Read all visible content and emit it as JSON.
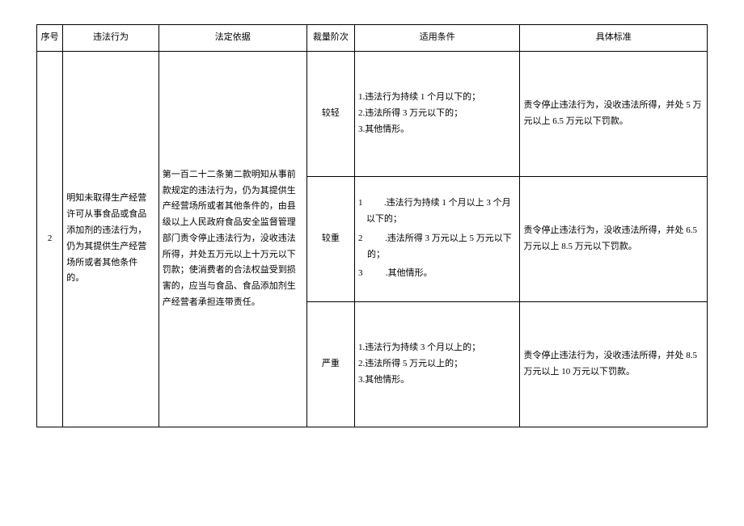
{
  "headers": {
    "seq": "序号",
    "violation": "违法行为",
    "basis": "法定依据",
    "level": "裁量阶次",
    "condition": "适用条件",
    "standard": "具体标准"
  },
  "row": {
    "seq": "2",
    "violation": "明知未取得生产经营许可从事食品或食品添加剂的违法行为，仍为其提供生产经营场所或者其他条件的。",
    "basis": "第一百二十二条第二款明知从事前款规定的违法行为，仍为其提供生产经营场所或者其他条件的，由县级以上人民政府食品安全监督管理部门责令停止违法行为，没收违法所得，并处五万元以上十万元以下罚款；使消费者的合法权益受到损害的，应当与食品、食品添加剂生产经营者承担连带责任。",
    "levels": {
      "light": {
        "name": "较轻",
        "condition_1": "1.违法行为持续 1 个月以下的；",
        "condition_2": "2.违法所得 3 万元以下的；",
        "condition_3": "3.其他情形。",
        "standard": "责令停止违法行为，没收违法所得，并处 5 万元以上 6.5 万元以下罚款。"
      },
      "heavy": {
        "name": "较重",
        "condition_1_num": "1",
        "condition_1_txt": "　　.违法行为持续 1 个月以上 3 个月以下的；",
        "condition_2_num": "2",
        "condition_2_txt": "　　.违法所得 3 万元以上 5 万元以下的；",
        "condition_3_num": "3",
        "condition_3_txt": "　　.其他情形。",
        "standard": "责令停止违法行为，没收违法所得，并处 6.5 万元以上 8.5 万元以下罚款。"
      },
      "severe": {
        "name": "严重",
        "condition_1": "1.违法行为持续 3 个月以上的；",
        "condition_2": "2.违法所得 5 万元以上的；",
        "condition_3": "3.其他情形。",
        "standard": "责令停止违法行为，没收违法所得，并处 8.5 万元以上 10 万元以下罚款。"
      }
    }
  }
}
